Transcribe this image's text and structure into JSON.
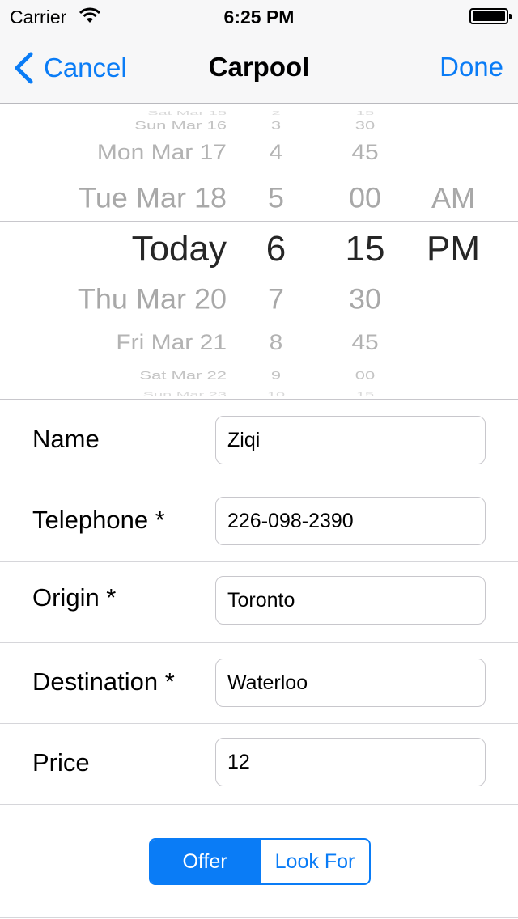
{
  "status_bar": {
    "carrier": "Carrier",
    "time": "6:25 PM"
  },
  "nav": {
    "cancel": "Cancel",
    "title": "Carpool",
    "done": "Done"
  },
  "picker": {
    "dates": [
      "Sat Mar 15",
      "Sun Mar 16",
      "Mon Mar 17",
      "Tue Mar 18",
      "Today",
      "Thu Mar 20",
      "Fri Mar 21",
      "Sat Mar 22",
      "Sun Mar 23"
    ],
    "hours": [
      "2",
      "3",
      "4",
      "5",
      "6",
      "7",
      "8",
      "9",
      "10"
    ],
    "minutes": [
      "15",
      "30",
      "45",
      "00",
      "15",
      "30",
      "45",
      "00",
      "15"
    ],
    "ampm": [
      "AM",
      "PM"
    ],
    "selected": {
      "date": "Today",
      "hour": "6",
      "minute": "15",
      "ampm": "PM"
    }
  },
  "form": {
    "name": {
      "label": "Name",
      "value": "Ziqi"
    },
    "telephone": {
      "label": "Telephone *",
      "value": "226-098-2390"
    },
    "origin": {
      "label": "Origin *",
      "value": "Toronto"
    },
    "destination": {
      "label": "Destination *",
      "value": "Waterloo"
    },
    "price": {
      "label": "Price",
      "value": "12"
    }
  },
  "segment": {
    "options": [
      "Offer",
      "Look For"
    ],
    "selected": "Offer"
  },
  "colors": {
    "accent": "#0a7cf6",
    "separator": "#c8c7cc",
    "bar": "#f7f7f8"
  },
  "icons": {
    "back": "chevron-left-icon",
    "wifi": "wifi-icon",
    "battery": "battery-icon"
  }
}
